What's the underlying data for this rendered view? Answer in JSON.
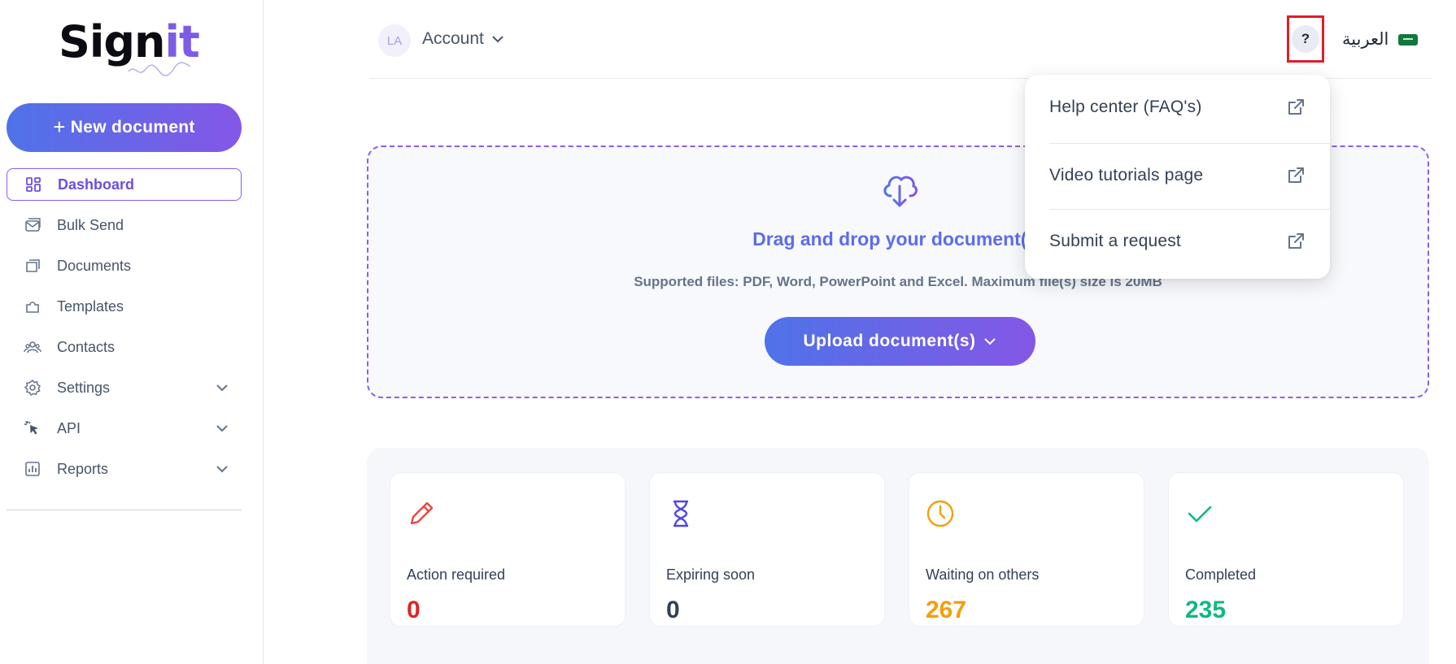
{
  "logo": {
    "main": "Sign",
    "accent": "it"
  },
  "sidebar": {
    "new_document": {
      "plus": "+",
      "label": "New document"
    },
    "items": [
      {
        "label": "Dashboard",
        "icon": "dashboard-icon",
        "active": true
      },
      {
        "label": "Bulk Send",
        "icon": "mail-icon"
      },
      {
        "label": "Documents",
        "icon": "documents-icon"
      },
      {
        "label": "Templates",
        "icon": "templates-icon"
      },
      {
        "label": "Contacts",
        "icon": "contacts-icon"
      },
      {
        "label": "Settings",
        "icon": "gear-icon",
        "expandable": true
      },
      {
        "label": "API",
        "icon": "cursor-icon",
        "expandable": true
      },
      {
        "label": "Reports",
        "icon": "chart-icon",
        "expandable": true
      }
    ]
  },
  "header": {
    "avatar_initials": "LA",
    "account_label": "Account",
    "help_label": "?",
    "language_label": "العربية"
  },
  "upload": {
    "title": "Drag and drop your document(s)",
    "supported": "Supported files: PDF, Word, PowerPoint and Excel. Maximum file(s) size is 20MB",
    "button_label": "Upload document(s)"
  },
  "stats": [
    {
      "label": "Action required",
      "value": "0",
      "color": "#dc2626",
      "icon": "pencil-icon"
    },
    {
      "label": "Expiring soon",
      "value": "0",
      "color": "#334155",
      "icon": "hourglass-icon"
    },
    {
      "label": "Waiting on others",
      "value": "267",
      "color": "#f59e0b",
      "icon": "clock-icon"
    },
    {
      "label": "Completed",
      "value": "235",
      "color": "#10b981",
      "icon": "check-icon"
    }
  ],
  "help_menu": {
    "items": [
      {
        "label": "Help center (FAQ's)",
        "icon": "external-link-icon"
      },
      {
        "label": "Video tutorials page",
        "icon": "external-link-icon"
      },
      {
        "label": "Submit a request",
        "icon": "external-link-icon"
      }
    ]
  },
  "colors": {
    "accent_start": "#4f73e8",
    "accent_end": "#8457e6",
    "highlight_border": "#e11d2a"
  }
}
